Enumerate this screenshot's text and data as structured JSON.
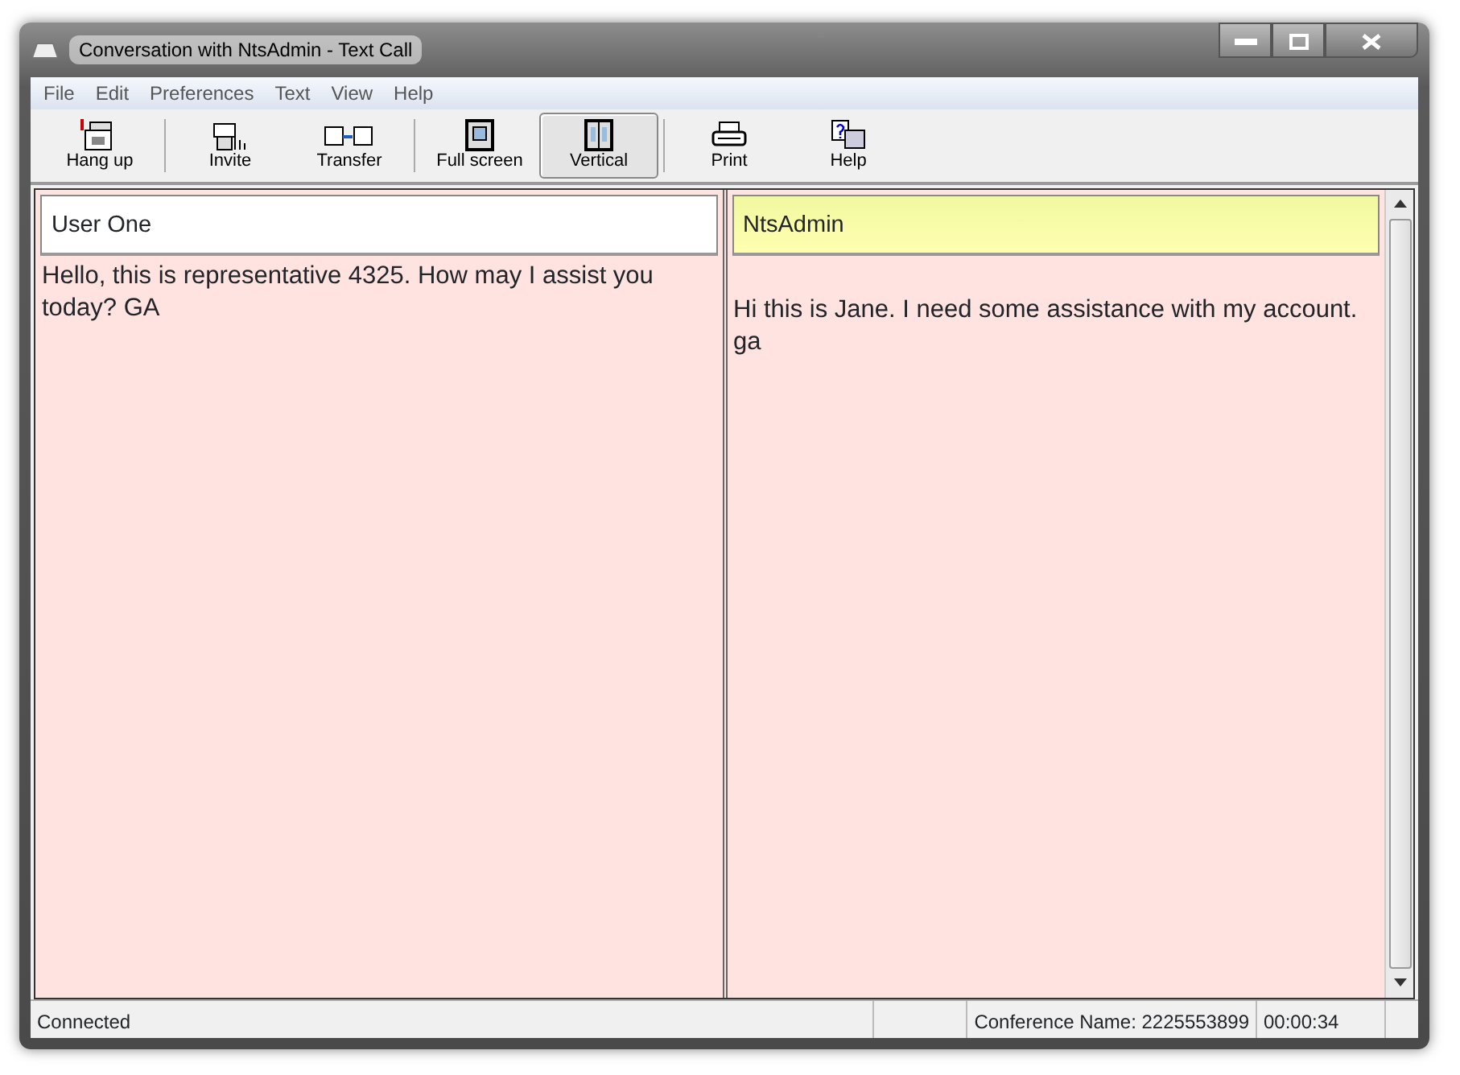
{
  "window": {
    "title": "Conversation with NtsAdmin - Text Call"
  },
  "menu": [
    "File",
    "Edit",
    "Preferences",
    "Text",
    "View",
    "Help"
  ],
  "toolbar": [
    {
      "label": "Hang up",
      "kind": "hangup",
      "pressed": false,
      "separator_after": true
    },
    {
      "label": "Invite",
      "kind": "invite",
      "pressed": false,
      "separator_after": false
    },
    {
      "label": "Transfer",
      "kind": "transfer",
      "pressed": false,
      "separator_after": true
    },
    {
      "label": "Full screen",
      "kind": "fullscreen",
      "pressed": false,
      "separator_after": false
    },
    {
      "label": "Vertical",
      "kind": "vertical",
      "pressed": true,
      "separator_after": true
    },
    {
      "label": "Print",
      "kind": "print",
      "pressed": false,
      "separator_after": false
    },
    {
      "label": "Help",
      "kind": "help",
      "pressed": false,
      "separator_after": false
    }
  ],
  "panes": [
    {
      "name": "User One",
      "color": "#ffffff",
      "text": "Hello, this is representative 4325. How may I assist you today?  GA",
      "leading_blank": false,
      "scrollbar": false
    },
    {
      "name": "NtsAdmin",
      "color": "#f0f8a0",
      "text": "Hi this is Jane.  I need some assistance with my account.  ga",
      "leading_blank": true,
      "scrollbar": true
    }
  ],
  "status_bar": [
    "Connected",
    "Conference Name: 2225553899",
    "00:00:34"
  ]
}
